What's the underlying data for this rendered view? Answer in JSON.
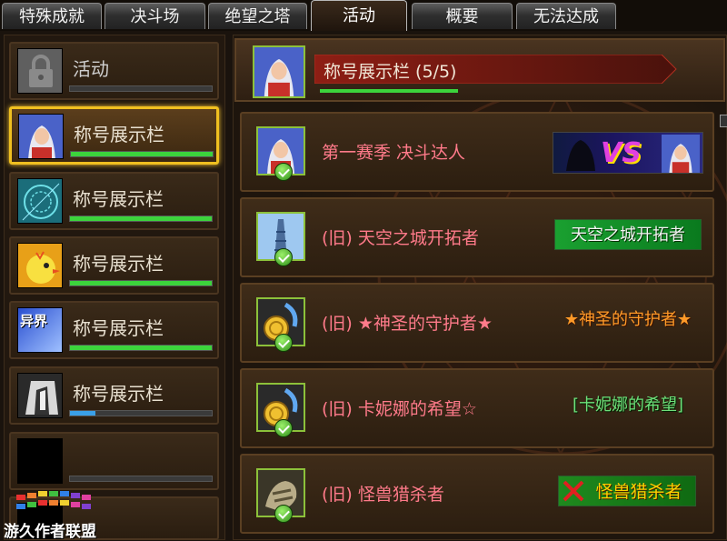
{
  "tabs": [
    {
      "label": "特殊成就",
      "active": false
    },
    {
      "label": "决斗场",
      "active": false
    },
    {
      "label": "绝望之塔",
      "active": false
    },
    {
      "label": "活动",
      "active": true
    },
    {
      "label": "概要",
      "active": false
    },
    {
      "label": "无法达成",
      "active": false
    }
  ],
  "sidebar": {
    "items": [
      {
        "label": "活动",
        "icon": "lock-icon",
        "progress": 0,
        "locked": true
      },
      {
        "label": "称号展示栏",
        "icon": "character-portrait-icon",
        "progress": 1.0,
        "selected": true
      },
      {
        "label": "称号展示栏",
        "icon": "magic-circle-icon",
        "progress": 1.0
      },
      {
        "label": "称号展示栏",
        "icon": "yellow-chick-icon",
        "progress": 1.0
      },
      {
        "label": "称号展示栏",
        "icon": "yijie-icon",
        "icon_text": "异界",
        "progress": 1.0
      },
      {
        "label": "称号展示栏",
        "icon": "tower-gate-icon",
        "progress": 0.18
      },
      {
        "label": "",
        "icon": "empty-slot-icon",
        "progress": 0
      },
      {
        "label": "",
        "icon": "empty-slot-icon",
        "progress": 0
      }
    ]
  },
  "header": {
    "title": "称号展示栏 (5/5)",
    "progress": 1.0,
    "icon": "character-portrait-icon"
  },
  "achievements": [
    {
      "title": "第一赛季 决斗达人",
      "icon": "character-portrait-icon",
      "badge": "VS",
      "badge_style": "vs-banner",
      "completed": true
    },
    {
      "title": "(旧) 天空之城开拓者",
      "icon": "sky-tower-icon",
      "badge": "天空之城开拓者",
      "badge_style": "green",
      "completed": true
    },
    {
      "title": "(旧) ★神圣的守护者★",
      "icon": "gold-coin-icon",
      "badge": "★神圣的守护者★",
      "badge_style": "orange",
      "completed": true
    },
    {
      "title": "(旧) 卡妮娜的希望☆",
      "icon": "gold-coin-icon",
      "badge": "[卡妮娜的希望]",
      "badge_style": "green-text",
      "completed": true
    },
    {
      "title": "(旧) 怪兽猎杀者",
      "icon": "bone-beast-icon",
      "badge": "怪兽猎杀者",
      "badge_style": "green-crossed",
      "completed": true
    }
  ],
  "watermark": {
    "text": "游久作者联盟",
    "icon": "watermark-logo-icon"
  },
  "colors": {
    "progress_green": "#3cd43c",
    "progress_blue": "#3aa0e8",
    "title_pink": "#ff7a8a",
    "selected_border": "#f0c020"
  }
}
